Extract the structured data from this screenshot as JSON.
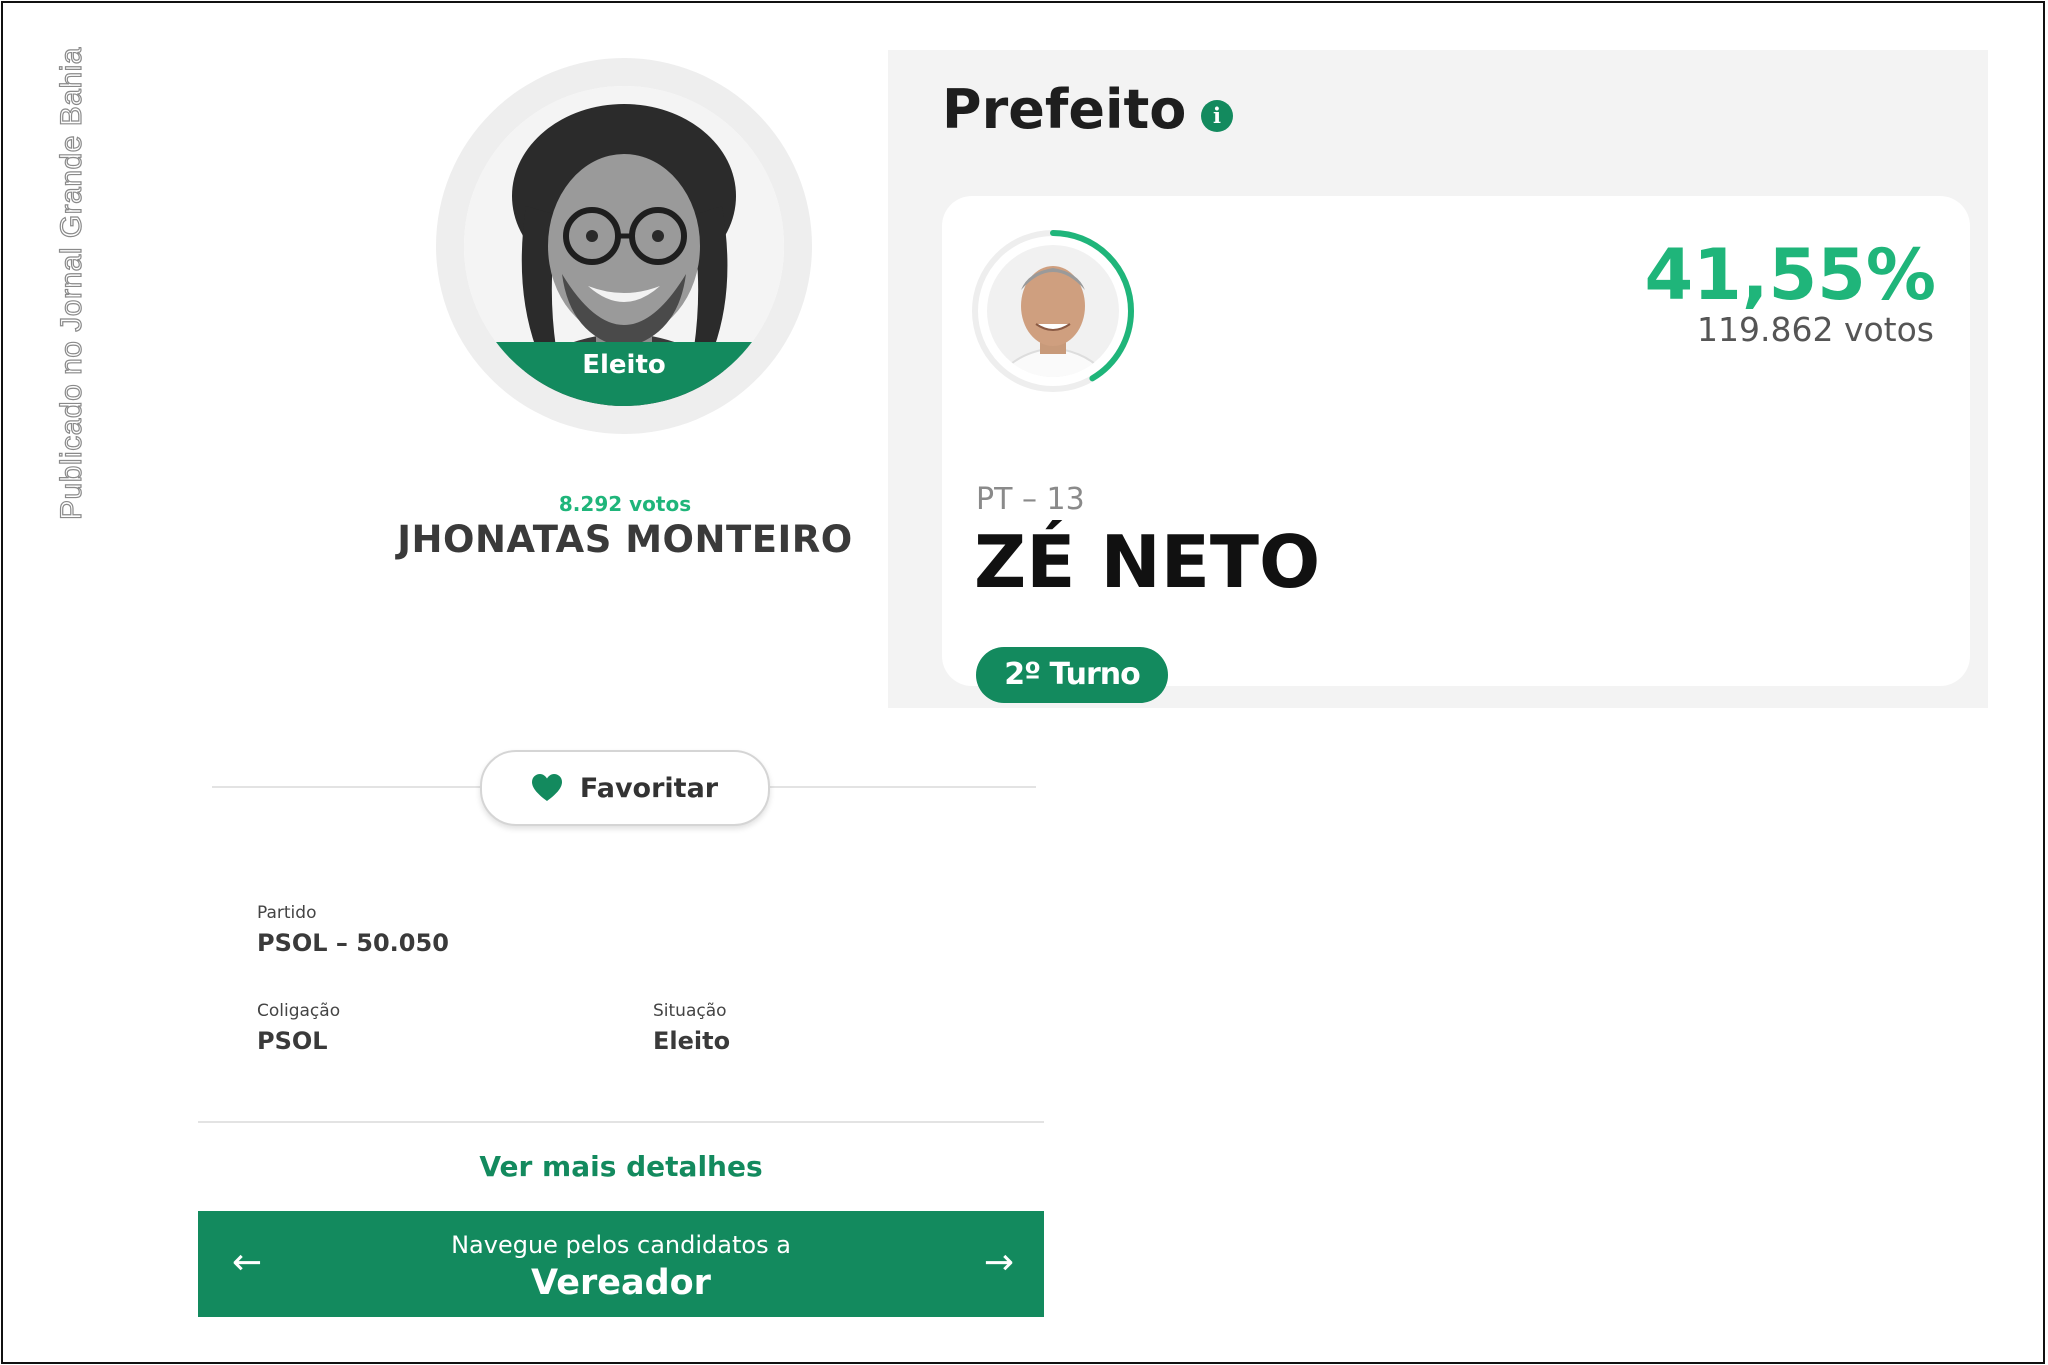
{
  "watermark": "Publicado no Jornal Grande Bahia",
  "candidate": {
    "badge": "Eleito",
    "votes": "8.292 votos",
    "name": "JHONATAS MONTEIRO"
  },
  "favorite": {
    "label": "Favoritar",
    "icon": "heart-icon"
  },
  "details": {
    "partido_label": "Partido",
    "partido_value": "PSOL – 50.050",
    "coligacao_label": "Coligação",
    "coligacao_value": "PSOL",
    "situacao_label": "Situação",
    "situacao_value": "Eleito"
  },
  "more_link": "Ver mais detalhes",
  "nav": {
    "subtitle": "Navegue pelos candidatos a",
    "title": "Vereador",
    "prev_icon": "arrow-left-icon",
    "next_icon": "arrow-right-icon"
  },
  "mayor": {
    "section_title": "Prefeito",
    "info_icon": "info-icon",
    "percentage": "41,55%",
    "percentage_value": 0.4155,
    "votes": "119.862 votos",
    "party": "PT – 13",
    "name": "ZÉ NETO",
    "round": "2º Turno"
  },
  "colors": {
    "accent": "#138a5e",
    "accent_light": "#1fb57a"
  }
}
